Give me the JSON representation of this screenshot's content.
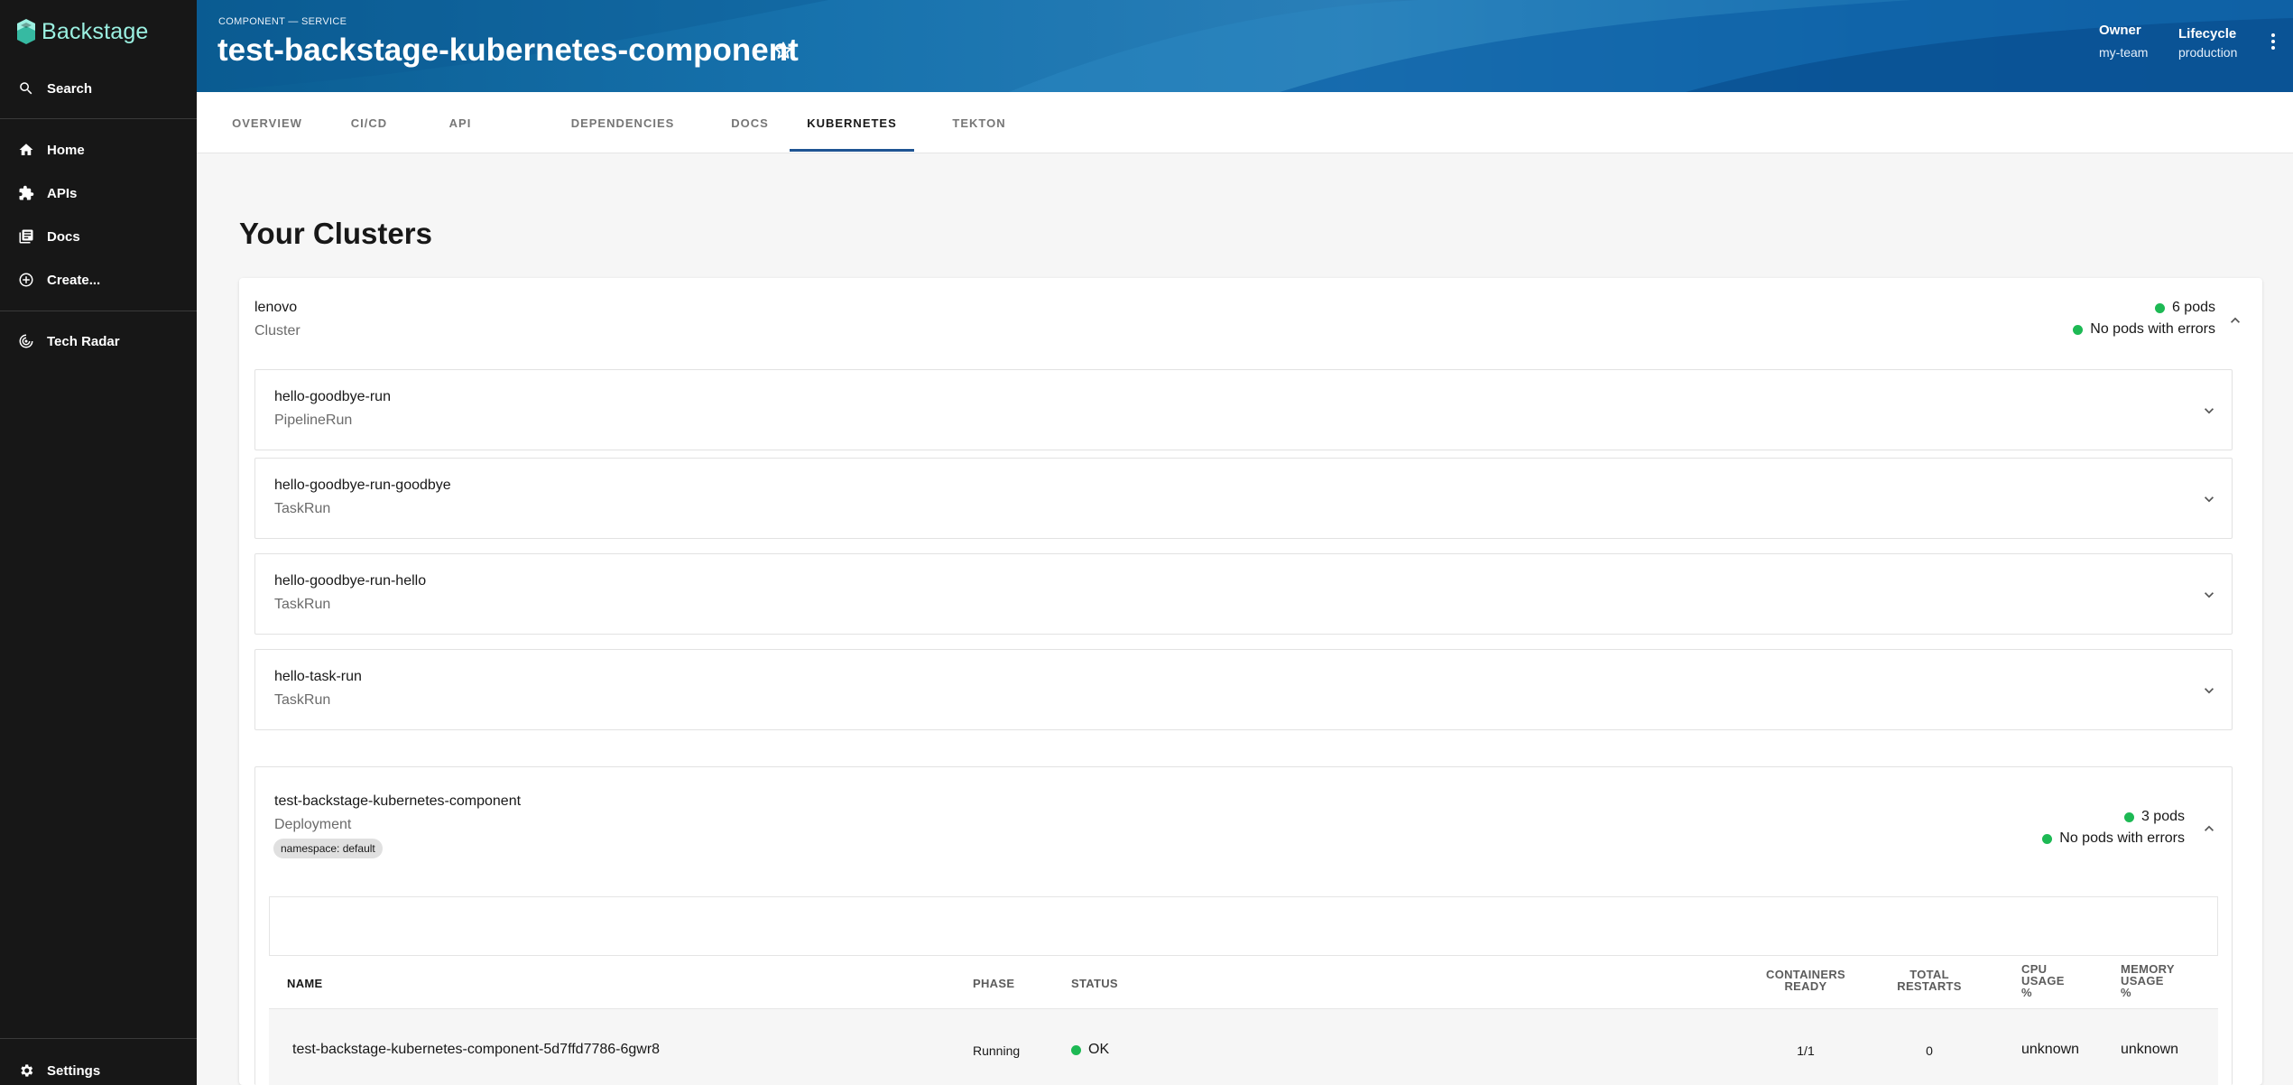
{
  "sidebar": {
    "logo_text": "Backstage",
    "search_label": "Search",
    "items": [
      {
        "label": "Home",
        "icon": "home-icon"
      },
      {
        "label": "APIs",
        "icon": "puzzle-icon"
      },
      {
        "label": "Docs",
        "icon": "library-icon"
      },
      {
        "label": "Create...",
        "icon": "add-circle-icon"
      }
    ],
    "tech_radar_label": "Tech Radar",
    "settings_label": "Settings"
  },
  "header": {
    "breadcrumb": "COMPONENT — SERVICE",
    "title": "test-backstage-kubernetes-component",
    "owner_label": "Owner",
    "owner_value": "my-team",
    "lifecycle_label": "Lifecycle",
    "lifecycle_value": "production"
  },
  "tabs": [
    "OVERVIEW",
    "CI/CD",
    "API",
    "DEPENDENCIES",
    "DOCS",
    "KUBERNETES",
    "TEKTON"
  ],
  "active_tab": "KUBERNETES",
  "main": {
    "heading": "Your Clusters",
    "cluster": {
      "name": "lenovo",
      "type": "Cluster",
      "pods": "6 pods",
      "errors": "No pods with errors"
    },
    "resources": [
      {
        "name": "hello-goodbye-run",
        "kind": "PipelineRun"
      },
      {
        "name": "hello-goodbye-run-goodbye",
        "kind": "TaskRun"
      },
      {
        "name": "hello-goodbye-run-hello",
        "kind": "TaskRun"
      },
      {
        "name": "hello-task-run",
        "kind": "TaskRun"
      }
    ],
    "deployment": {
      "name": "test-backstage-kubernetes-component",
      "kind": "Deployment",
      "namespace_badge": "namespace: default",
      "pods": "3 pods",
      "errors": "No pods with errors"
    },
    "table": {
      "headers": {
        "name": "NAME",
        "phase": "PHASE",
        "status": "STATUS",
        "containers_ready_1": "CONTAINERS",
        "containers_ready_2": "READY",
        "total_restarts_1": "TOTAL",
        "total_restarts_2": "RESTARTS",
        "cpu_1": "CPU",
        "cpu_2": "USAGE",
        "cpu_3": "%",
        "mem_1": "MEMORY",
        "mem_2": "USAGE",
        "mem_3": "%"
      },
      "rows": [
        {
          "name": "test-backstage-kubernetes-component-5d7ffd7786-6gwr8",
          "phase": "Running",
          "status": "OK",
          "containers_ready": "1/1",
          "total_restarts": "0",
          "cpu": "unknown",
          "memory": "unknown"
        }
      ]
    }
  },
  "colors": {
    "sidebar_bg": "#171717",
    "logo": "#9bf0e1",
    "header_blue": "#1772ad",
    "tab_active_underline": "#1f5493",
    "status_ok": "#1db954"
  }
}
